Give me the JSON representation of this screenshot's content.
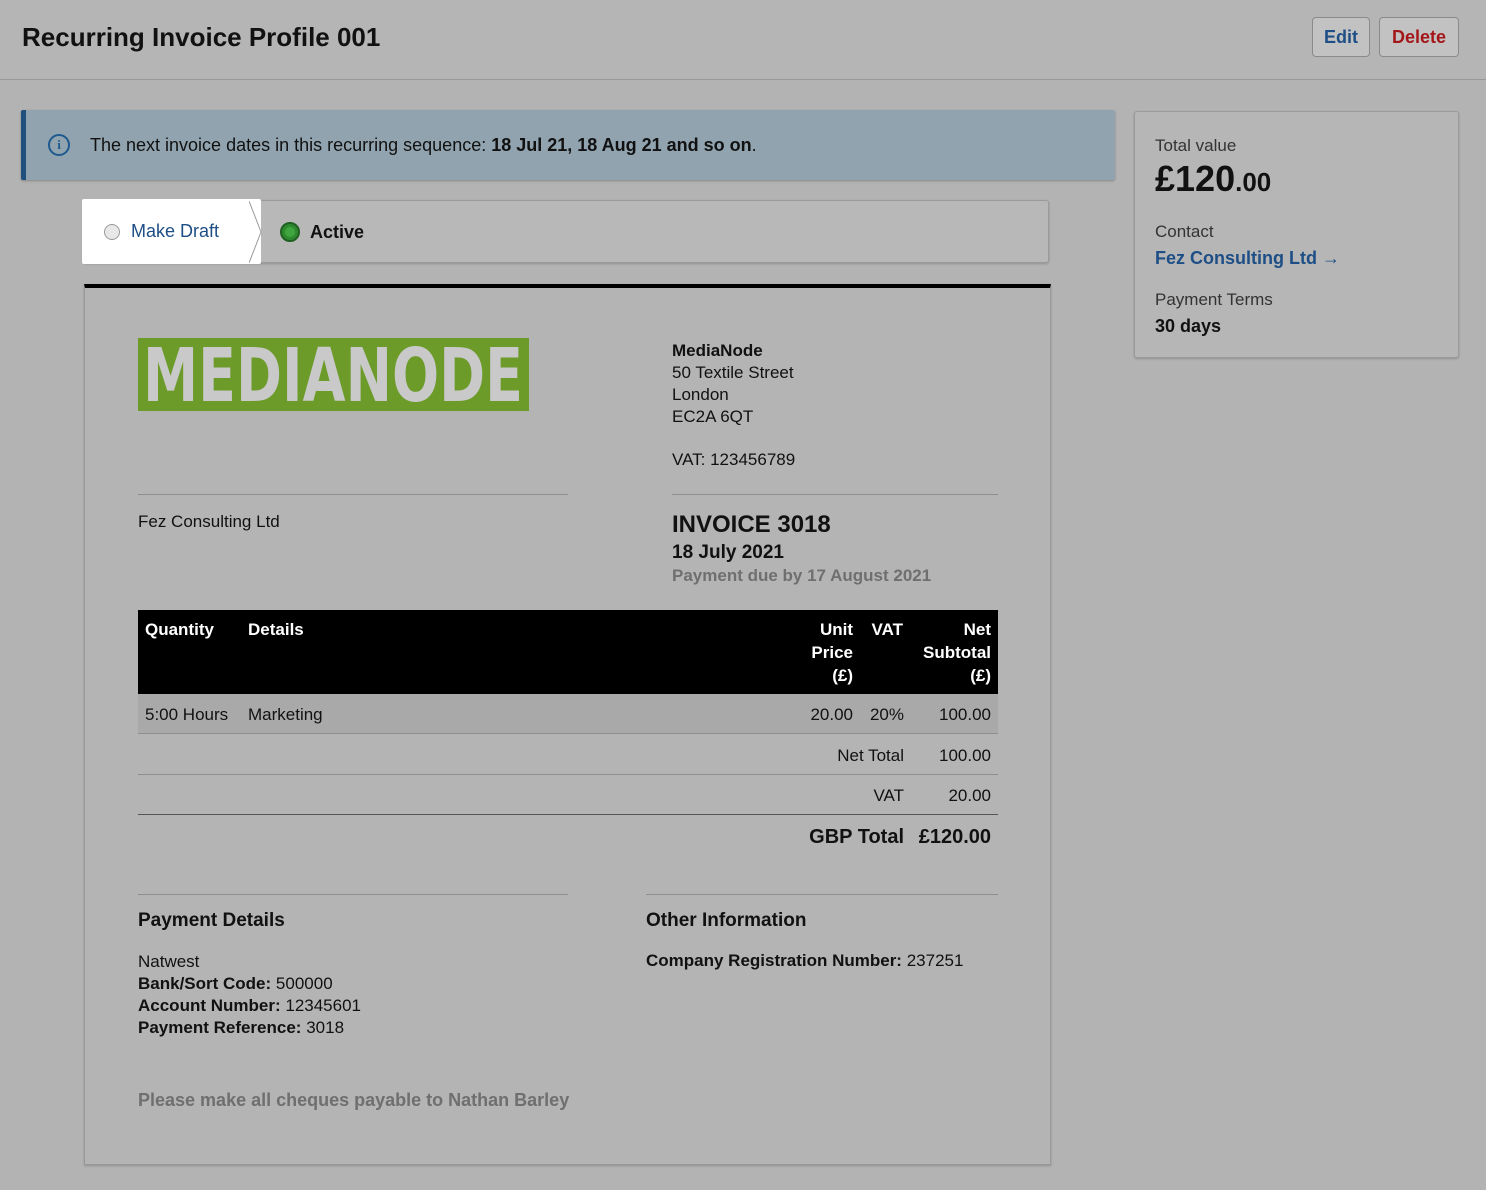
{
  "header": {
    "title": "Recurring Invoice Profile 001",
    "edit_label": "Edit",
    "delete_label": "Delete"
  },
  "banner": {
    "prefix": "The next invoice dates in this recurring sequence: ",
    "dates": "18 Jul 21, 18 Aug 21 and so on",
    "suffix": "."
  },
  "status_steps": {
    "draft_label": "Make Draft",
    "active_label": "Active"
  },
  "invoice": {
    "logo_text": "MEDIANODE",
    "sender": {
      "name": "MediaNode",
      "street": "50 Textile Street",
      "city": "London",
      "postcode": "EC2A 6QT",
      "vat": "VAT: 123456789"
    },
    "recipient": "Fez Consulting Ltd",
    "number": "INVOICE 3018",
    "date": "18 July 2021",
    "due": "Payment due by 17 August 2021",
    "table": {
      "headers": {
        "quantity": "Quantity",
        "details": "Details",
        "unit_price": [
          "Unit",
          "Price",
          "(£)"
        ],
        "vat": "VAT",
        "net_subtotal": [
          "Net",
          "Subtotal",
          "(£)"
        ]
      },
      "rows": [
        {
          "quantity": "5:00 Hours",
          "details": "Marketing",
          "unit_price": "20.00",
          "vat": "20%",
          "net": "100.00"
        }
      ],
      "net_total_label": "Net Total",
      "net_total_value": "100.00",
      "vat_label": "VAT",
      "vat_value": "20.00",
      "gbp_total_label": "GBP Total",
      "gbp_total_value": "£120.00"
    },
    "payment_details": {
      "title": "Payment Details",
      "bank": "Natwest",
      "sort_code_label": "Bank/Sort Code:",
      "sort_code": "500000",
      "account_label": "Account Number:",
      "account": "12345601",
      "reference_label": "Payment Reference:",
      "reference": "3018"
    },
    "other_information": {
      "title": "Other Information",
      "reg_label": "Company Registration Number:",
      "reg_value": "237251"
    },
    "cheques_note": "Please make all cheques payable to Nathan Barley"
  },
  "sidebar": {
    "total_label": "Total value",
    "total_main": "£120",
    "total_pence": ".00",
    "contact_label": "Contact",
    "contact_name": "Fez Consulting Ltd →",
    "terms_label": "Payment Terms",
    "terms_value": "30 days"
  },
  "colors": {
    "link": "#1d4e86",
    "delete": "#a3171a",
    "logo_green": "#6c9b2a",
    "active_green": "#2f8a2f",
    "banner_bg": "#90a3ae"
  }
}
